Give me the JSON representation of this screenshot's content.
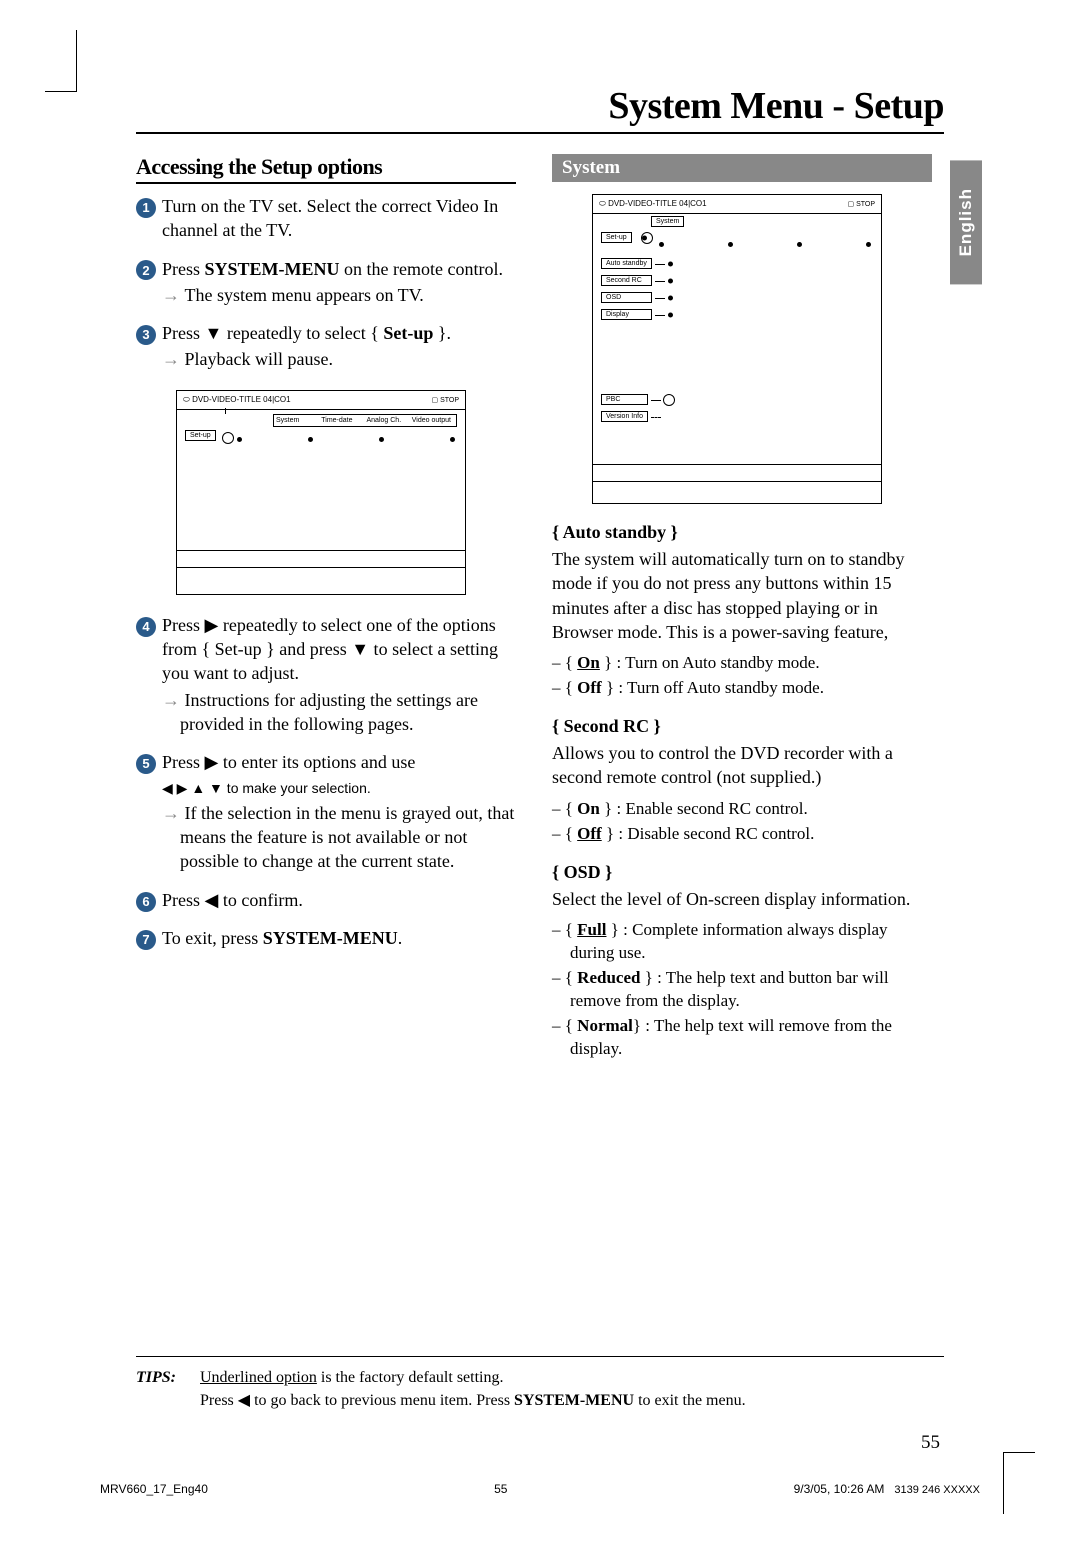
{
  "title": "System Menu - Setup",
  "sideTab": "English",
  "left": {
    "heading": "Accessing the Setup options",
    "steps": {
      "s1": "Turn on the TV set.  Select the correct Video In channel at the TV.",
      "s2a": "Press ",
      "s2b": "SYSTEM-MENU",
      "s2c": " on the remote control.",
      "s2r": "The system menu appears on TV.",
      "s3a": "Press ▼ repeatedly to select { ",
      "s3b": "Set-up",
      "s3c": " }.",
      "s3r": "Playback will pause.",
      "s4": "Press ▶ repeatedly to select one of the options from { Set-up } and press ▼ to select a setting you want to adjust.",
      "s4r": "Instructions for adjusting the settings are provided in the following pages.",
      "s5a": "Press ▶ to enter its options and use",
      "s5b": "◀ ▶ ▲ ▼  to make your selection.",
      "s5r": "If the selection in the menu is grayed out, that means the feature is not available or not possible to change at the current state.",
      "s6": "Press ◀ to confirm.",
      "s7a": "To exit, press ",
      "s7b": "SYSTEM-MENU",
      "s7c": "."
    },
    "osd": {
      "title": "DVD-VIDEO-TITLE 04|CO1",
      "stop": "STOP",
      "tabs": {
        "a": "System",
        "b": "Time-date",
        "c": "Analog Ch.",
        "d": "Video output"
      },
      "setup": "Set-up"
    }
  },
  "right": {
    "banner": "System",
    "osd2": {
      "title": "DVD-VIDEO-TITLE 04|CO1",
      "stop": "STOP",
      "system": "System",
      "items": {
        "setup": "Set-up",
        "auto": "Auto standby",
        "second": "Second RC",
        "osd": "OSD",
        "display": "Display",
        "pbc": "PBC",
        "version": "Version Info"
      }
    },
    "auto": {
      "head": "{ Auto standby }",
      "body": "The system will automatically turn on to standby mode if you do not press any buttons within 15 minutes after a disc has stopped playing or in Browser mode. This is a power-saving feature,",
      "on": {
        "l": "On",
        "t": " } : Turn on Auto standby mode."
      },
      "off": {
        "l": "Off",
        "t": " } : Turn off Auto standby mode."
      }
    },
    "second": {
      "head": "{ Second RC }",
      "body": "Allows you to control the DVD recorder with a second remote control (not supplied.)",
      "on": {
        "l": "On",
        "t": " } : Enable second RC control."
      },
      "off": {
        "l": "Off",
        "t": " } : Disable second RC control."
      }
    },
    "osdOpt": {
      "head": "{ OSD }",
      "body": "Select the level of On-screen display information.",
      "full": {
        "l": "Full",
        "t": " } : Complete information always display during use."
      },
      "reduced": {
        "l": "Reduced",
        "t": " } : The help text and button bar will remove from the display."
      },
      "normal": {
        "l": "Normal",
        "t": "} : The help text will remove from the display."
      }
    }
  },
  "tips": {
    "label": "TIPS:",
    "line1a": "Underlined option",
    "line1b": " is the factory default setting.",
    "line2a": "Press ◀ to go back to previous menu item.  Press ",
    "line2b": "SYSTEM-MENU",
    "line2c": " to exit the menu."
  },
  "pageNum": "55",
  "footer": {
    "left": "MRV660_17_Eng40",
    "center": "55",
    "right1": "9/3/05, 10:26 AM",
    "right2": "3139 246 XXXXX"
  }
}
